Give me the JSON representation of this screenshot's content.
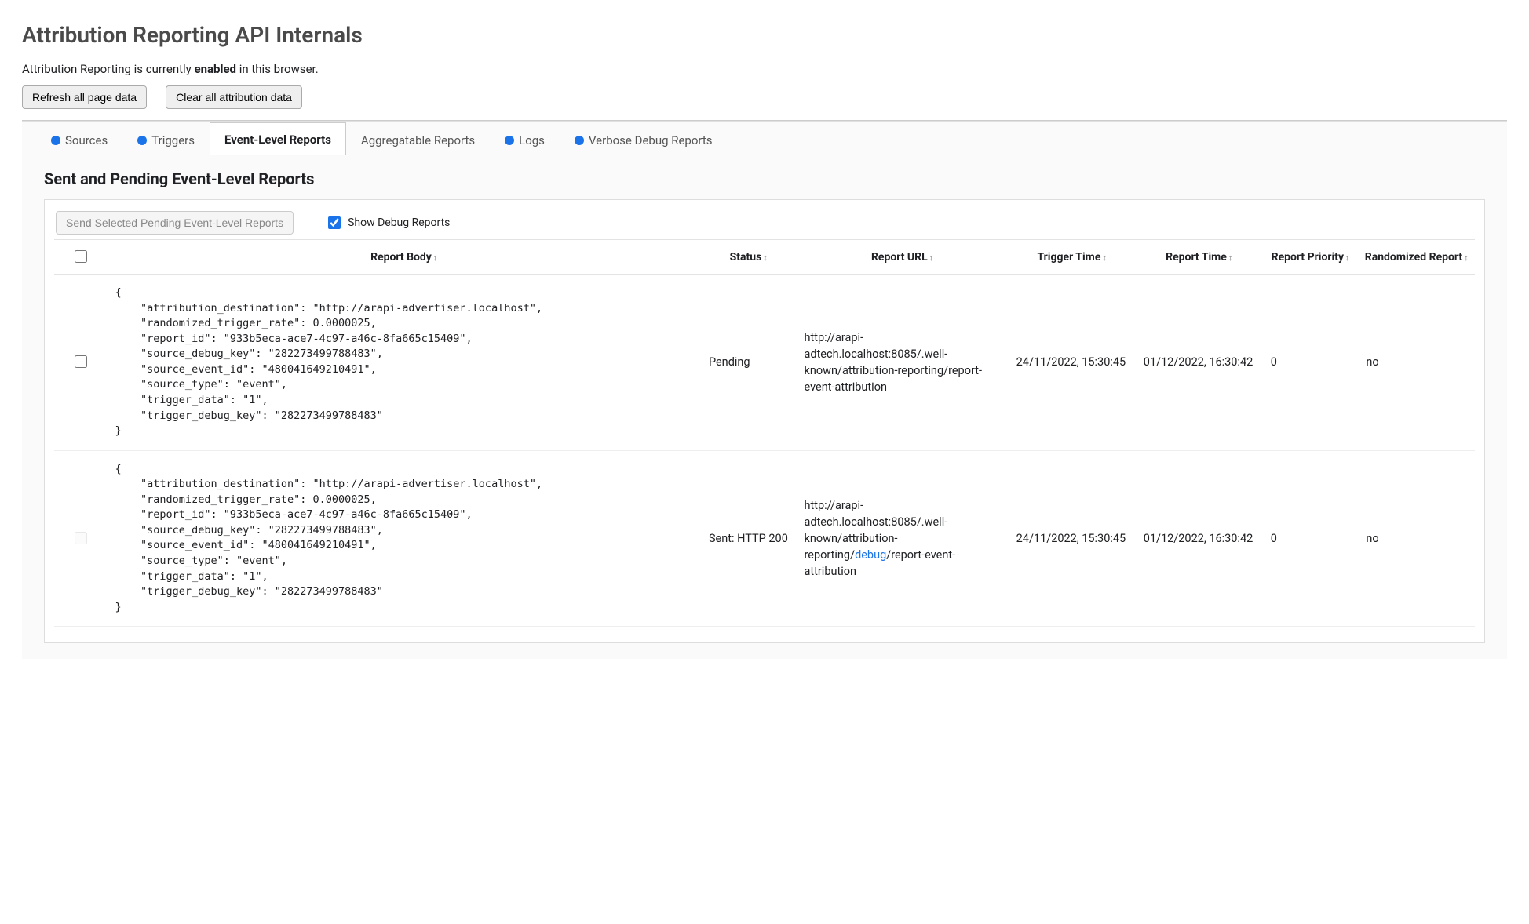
{
  "header": {
    "title": "Attribution Reporting API Internals",
    "status_prefix": "Attribution Reporting is currently ",
    "status_value": "enabled",
    "status_suffix": " in this browser.",
    "refresh_label": "Refresh all page data",
    "clear_label": "Clear all attribution data"
  },
  "tabs": [
    {
      "label": "Sources",
      "dot": true,
      "active": false
    },
    {
      "label": "Triggers",
      "dot": true,
      "active": false
    },
    {
      "label": "Event-Level Reports",
      "dot": false,
      "active": true
    },
    {
      "label": "Aggregatable Reports",
      "dot": false,
      "active": false
    },
    {
      "label": "Logs",
      "dot": true,
      "active": false
    },
    {
      "label": "Verbose Debug Reports",
      "dot": true,
      "active": false
    }
  ],
  "section": {
    "title": "Sent and Pending Event-Level Reports",
    "send_button": "Send Selected Pending Event-Level Reports",
    "show_debug_label": "Show Debug Reports",
    "show_debug_checked": true
  },
  "columns": [
    "Report Body",
    "Status",
    "Report URL",
    "Trigger Time",
    "Report Time",
    "Report Priority",
    "Randomized Report"
  ],
  "rows": [
    {
      "selectable": true,
      "body": "{\n    \"attribution_destination\": \"http://arapi-advertiser.localhost\",\n    \"randomized_trigger_rate\": 0.0000025,\n    \"report_id\": \"933b5eca-ace7-4c97-a46c-8fa665c15409\",\n    \"source_debug_key\": \"282273499788483\",\n    \"source_event_id\": \"480041649210491\",\n    \"source_type\": \"event\",\n    \"trigger_data\": \"1\",\n    \"trigger_debug_key\": \"282273499788483\"\n}",
      "status": "Pending",
      "url_pre": "http://arapi-adtech.localhost:8085/.well-known/attribution-reporting/",
      "url_debug": "",
      "url_post": "report-event-attribution",
      "trigger_time": "24/11/2022, 15:30:45",
      "report_time": "01/12/2022, 16:30:42",
      "priority": "0",
      "randomized": "no"
    },
    {
      "selectable": false,
      "body": "{\n    \"attribution_destination\": \"http://arapi-advertiser.localhost\",\n    \"randomized_trigger_rate\": 0.0000025,\n    \"report_id\": \"933b5eca-ace7-4c97-a46c-8fa665c15409\",\n    \"source_debug_key\": \"282273499788483\",\n    \"source_event_id\": \"480041649210491\",\n    \"source_type\": \"event\",\n    \"trigger_data\": \"1\",\n    \"trigger_debug_key\": \"282273499788483\"\n}",
      "status": "Sent: HTTP 200",
      "url_pre": "http://arapi-adtech.localhost:8085/.well-known/attribution-reporting/",
      "url_debug": "debug",
      "url_post": "/report-event-attribution",
      "trigger_time": "24/11/2022, 15:30:45",
      "report_time": "01/12/2022, 16:30:42",
      "priority": "0",
      "randomized": "no"
    }
  ]
}
